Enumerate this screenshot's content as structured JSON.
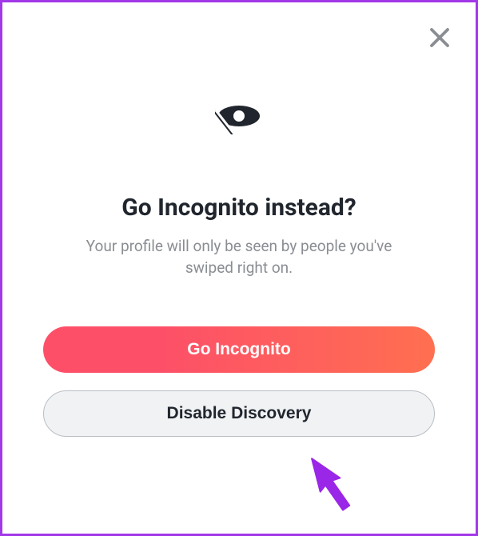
{
  "modal": {
    "title": "Go Incognito instead?",
    "subtitle": "Your profile will only be seen by people you've swiped right on.",
    "primary_button": "Go Incognito",
    "secondary_button": "Disable Discovery"
  },
  "colors": {
    "accent_gradient_start": "#fd5068",
    "accent_gradient_end": "#ff6f50",
    "frame_border": "#a238e8",
    "text_dark": "#21262e",
    "text_muted": "#8a8e93"
  },
  "icons": {
    "close": "close-icon",
    "incognito": "eye-slash-icon",
    "pointer": "arrow-pointer"
  }
}
